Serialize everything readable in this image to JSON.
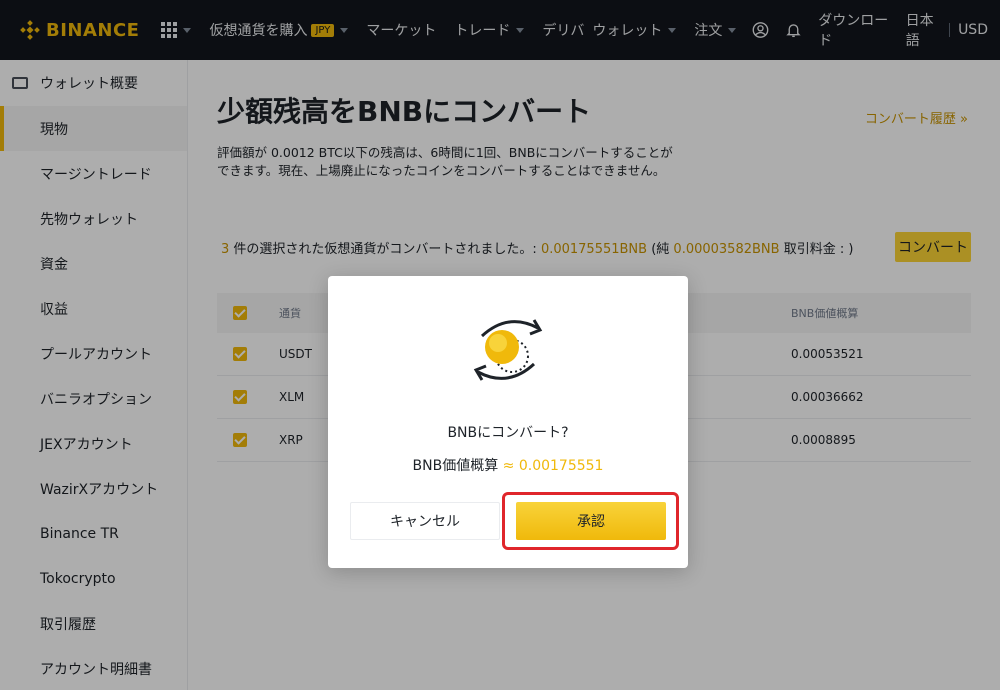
{
  "nav": {
    "logo": "BINANCE",
    "items": [
      {
        "label": "仮想通貨を購入",
        "badge": "JPY"
      },
      {
        "label": "マーケット"
      },
      {
        "label": "トレード"
      },
      {
        "label": "デリバ"
      },
      {
        "label": "ウォレット"
      },
      {
        "label": "注文"
      }
    ],
    "download": "ダウンロード",
    "language": "日本語",
    "currency": "USD"
  },
  "sidebar": {
    "header": "ウォレット概要",
    "items": [
      {
        "label": "現物",
        "active": true
      },
      {
        "label": "マージントレード"
      },
      {
        "label": "先物ウォレット"
      },
      {
        "label": "資金"
      },
      {
        "label": "収益"
      },
      {
        "label": "プールアカウント"
      },
      {
        "label": "バニラオプション"
      },
      {
        "label": "JEXアカウント"
      },
      {
        "label": "WazirXアカウント"
      },
      {
        "label": "Binance TR"
      },
      {
        "label": "Tokocrypto"
      },
      {
        "label": "取引履歴"
      },
      {
        "label": "アカウント明細書"
      }
    ]
  },
  "main": {
    "title": "少額残高をBNBにコンバート",
    "history_link": "コンバート履歴 »",
    "description": "評価額が 0.0012 BTC以下の残高は、6時間に1回、BNBにコンバートすることができます。現在、上場廃止になったコインをコンバートすることはできません。",
    "summary": {
      "count": "3",
      "text1": " 件の選択された仮想通貨がコンバートされました。: ",
      "amount": "0.00175551BNB",
      "text2": " (純 ",
      "net": "0.00003582BNB",
      "text3": " 取引料金 : )"
    },
    "convert_button": "コンバート",
    "table": {
      "headers": {
        "currency": "通貨",
        "bnb_value": "BNB価値概算"
      },
      "rows": [
        {
          "currency": "USDT",
          "value": "0.00053521"
        },
        {
          "currency": "XLM",
          "value": "0.00036662"
        },
        {
          "currency": "XRP",
          "value": "0.0008895"
        }
      ]
    }
  },
  "modal": {
    "question": "BNBにコンバート?",
    "value_label": "BNB価値概算",
    "approx": " ≈ ",
    "value": "0.00175551",
    "cancel": "キャンセル",
    "approve": "承認"
  },
  "colors": {
    "accent": "#f0b90b",
    "nav_bg": "#12161c",
    "highlight": "#e0262b"
  }
}
